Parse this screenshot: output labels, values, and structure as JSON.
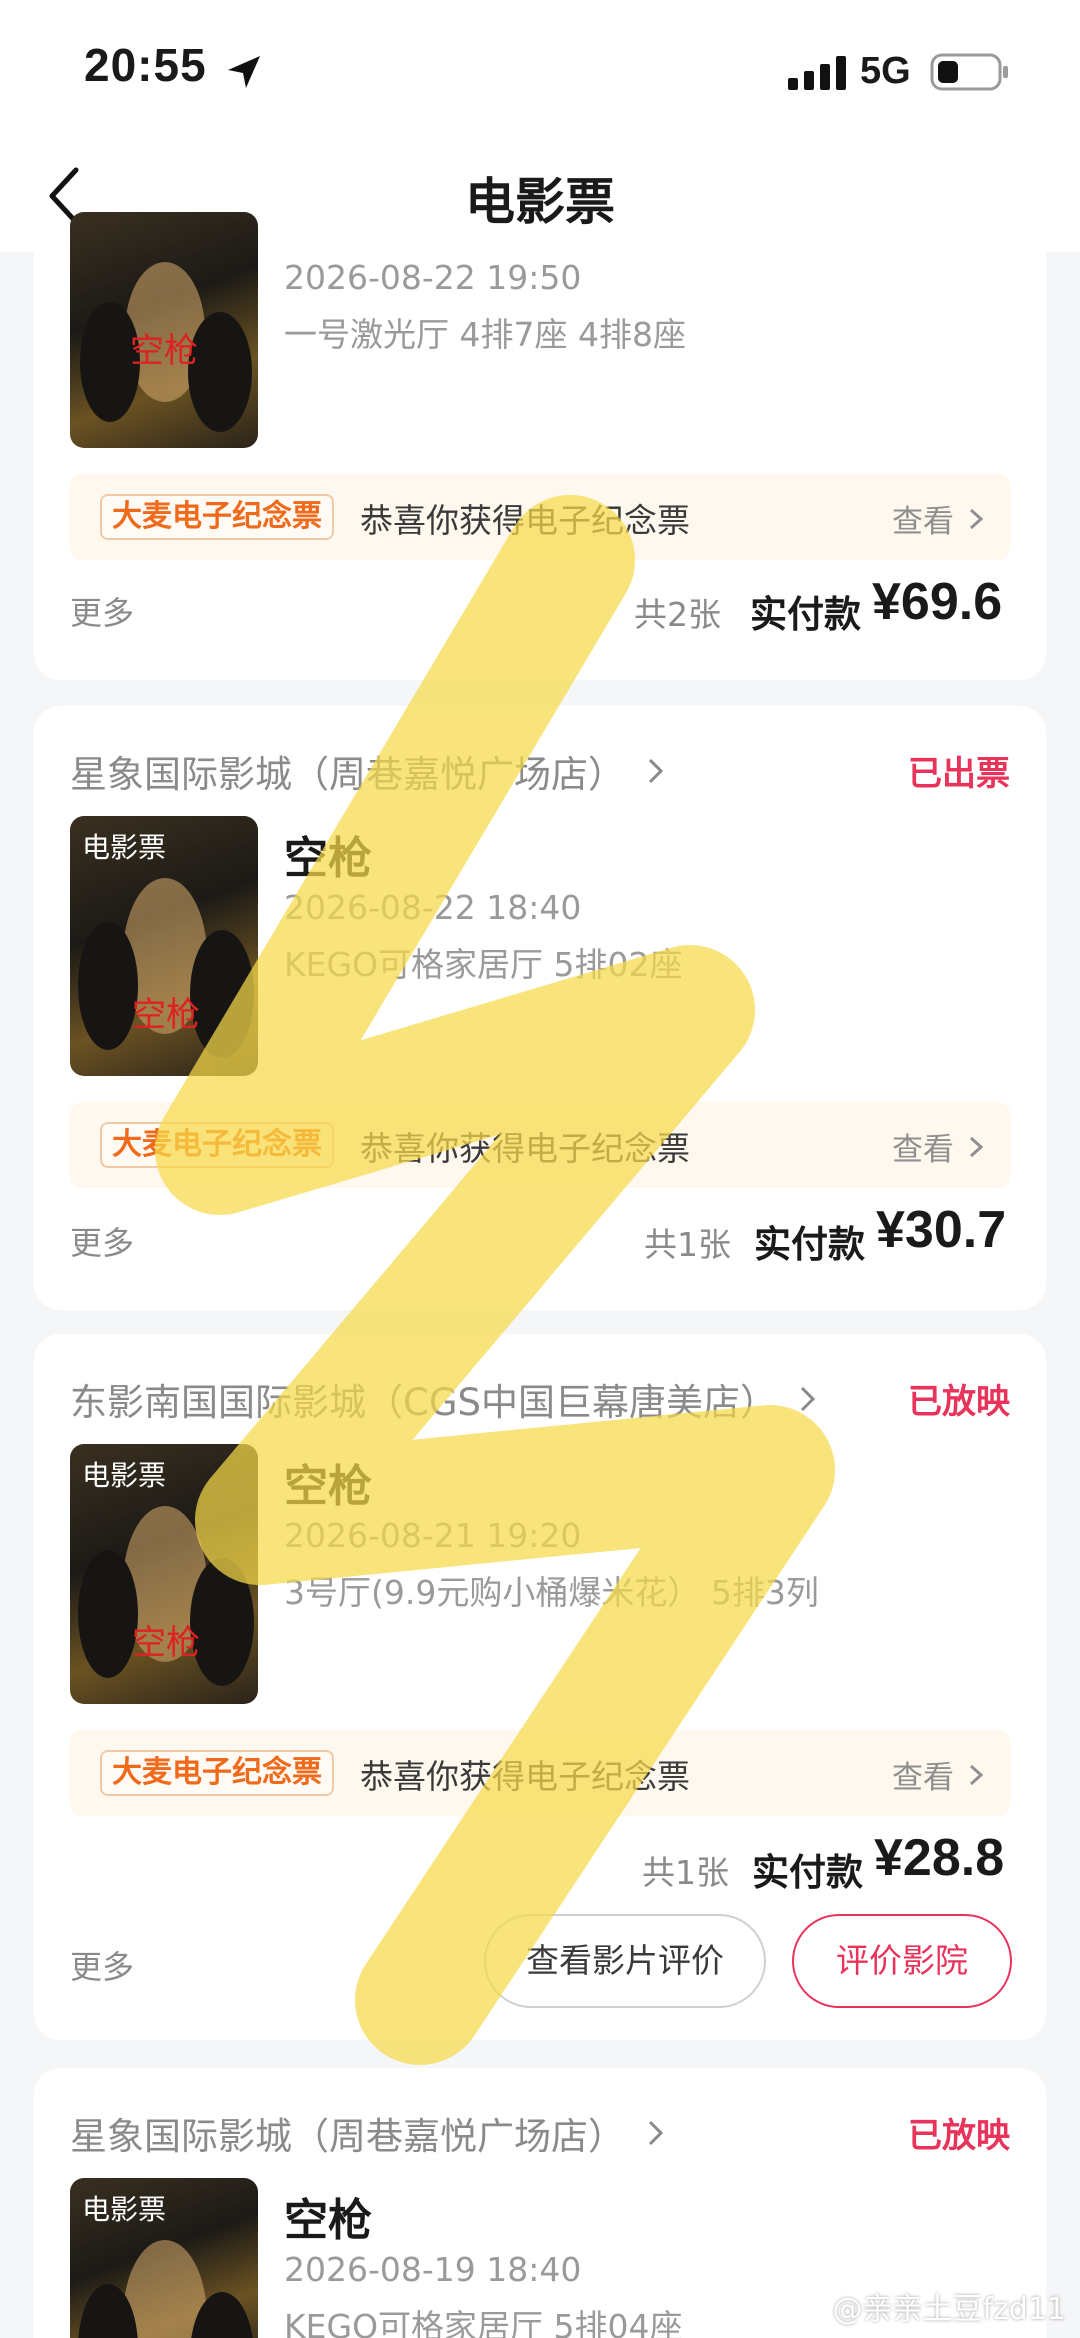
{
  "status_bar": {
    "time": "20:55",
    "network": "5G"
  },
  "nav": {
    "title": "电影票"
  },
  "orders": [
    {
      "cinema": "",
      "status": "",
      "title": "",
      "time": "2026-08-22 19:50",
      "seats": "一号激光厅 4排7座 4排8座",
      "souvenir_tag": "大麦电子纪念票",
      "souvenir_text": "恭喜你获得电子纪念票",
      "view_label": "查看",
      "more_label": "更多",
      "count": "共2张",
      "paid_label": "实付款",
      "price": "¥69.6"
    },
    {
      "cinema": "星象国际影城（周巷嘉悦广场店）",
      "status": "已出票",
      "poster_tag": "电影票",
      "title": "空枪",
      "time": "2026-08-22 18:40",
      "seats": "KEGO可格家居厅 5排02座",
      "souvenir_tag": "大麦电子纪念票",
      "souvenir_text": "恭喜你获得电子纪念票",
      "view_label": "查看",
      "more_label": "更多",
      "count": "共1张",
      "paid_label": "实付款",
      "price": "¥30.7"
    },
    {
      "cinema": "东影南国国际影城（CGS中国巨幕唐美店）",
      "status": "已放映",
      "poster_tag": "电影票",
      "title": "空枪",
      "time": "2026-08-21 19:20",
      "seats": "3号厅(9.9元购小桶爆米花） 5排3列",
      "souvenir_tag": "大麦电子纪念票",
      "souvenir_text": "恭喜你获得电子纪念票",
      "view_label": "查看",
      "more_label": "更多",
      "count": "共1张",
      "paid_label": "实付款",
      "price": "¥28.8",
      "btn_review_movie": "查看影片评价",
      "btn_rate_cinema": "评价影院"
    },
    {
      "cinema": "星象国际影城（周巷嘉悦广场店）",
      "status": "已放映",
      "poster_tag": "电影票",
      "title": "空枪",
      "time": "2026-08-19 18:40",
      "seats": "KEGO可格家居厅 5排04座"
    }
  ],
  "poster_title_text": "空枪",
  "watermark": "@亲亲土豆fzd11",
  "colors": {
    "accent_pink": "#e8335a",
    "souvenir_orange": "#ef6a1b",
    "highlighter": "#f7d94a"
  }
}
